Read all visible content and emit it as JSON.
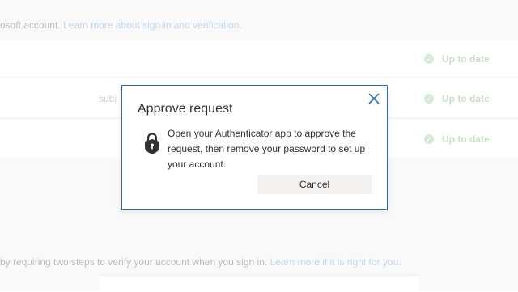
{
  "background": {
    "intro_text": "osoft account.",
    "intro_link": "Learn more about sign-in and verification.",
    "rows": [
      {
        "fragment": "",
        "status": "Up to date"
      },
      {
        "fragment": "subi",
        "status": "Up to date"
      },
      {
        "fragment": "",
        "status": "Up to date"
      }
    ],
    "two_step_text": "by requiring two steps to verify your account when you sign in.",
    "two_step_link": "Learn more if it is right for you."
  },
  "dialog": {
    "title": "Approve request",
    "message": "Open your Authenticator app to approve the request, then remove your password to set up your account.",
    "cancel_label": "Cancel",
    "close_icon": "close-icon",
    "lock_icon": "lock-icon"
  },
  "colors": {
    "dialog_border": "#2b6cb0",
    "close_icon": "#2b6cb0",
    "status_green": "#c9dfc7"
  }
}
